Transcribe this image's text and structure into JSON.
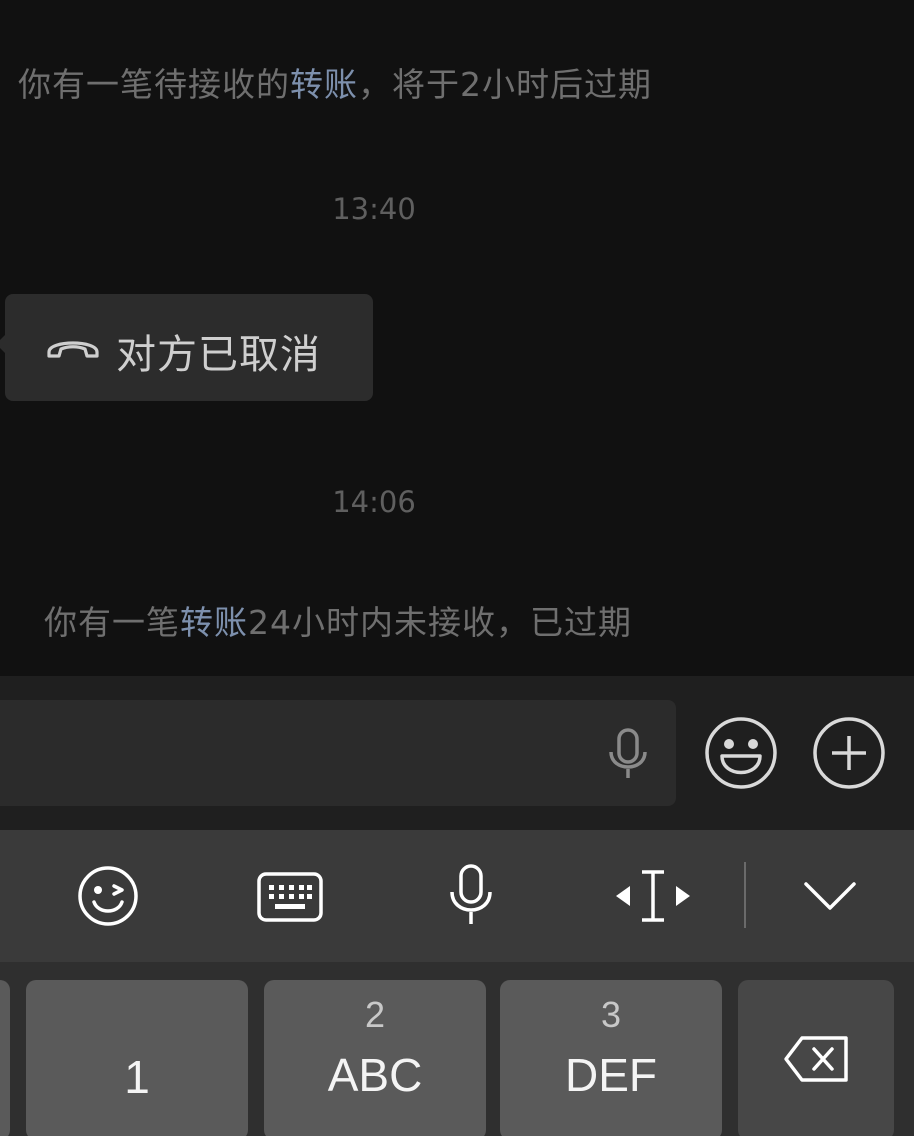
{
  "chat": {
    "messages": [
      {
        "type": "system",
        "prefix": "你有一笔待接收的",
        "link": "转账",
        "suffix": "，将于2小时后过期"
      },
      {
        "type": "timestamp",
        "text": "13:40"
      },
      {
        "type": "call",
        "icon": "hang-up-phone-icon",
        "text": "对方已取消"
      },
      {
        "type": "timestamp",
        "text": "14:06"
      },
      {
        "type": "system",
        "prefix": "你有一笔",
        "link": "转账",
        "suffix": "24小时内未接收，已过期"
      }
    ],
    "link_color": "#7d90ad"
  },
  "input_bar": {
    "value": "",
    "icons": [
      "voice-mic-icon",
      "emoji-icon",
      "plus-icon"
    ]
  },
  "keyboard_toolbar": {
    "icons": [
      "emoji-wink-icon",
      "keyboard-icon",
      "mic-icon",
      "cursor-move-icon",
      "collapse-chevron-icon"
    ]
  },
  "keypad": {
    "keys": [
      {
        "top": "",
        "main": "1"
      },
      {
        "top": "2",
        "main": "ABC"
      },
      {
        "top": "3",
        "main": "DEF"
      }
    ],
    "delete_icon": "backspace-icon"
  }
}
